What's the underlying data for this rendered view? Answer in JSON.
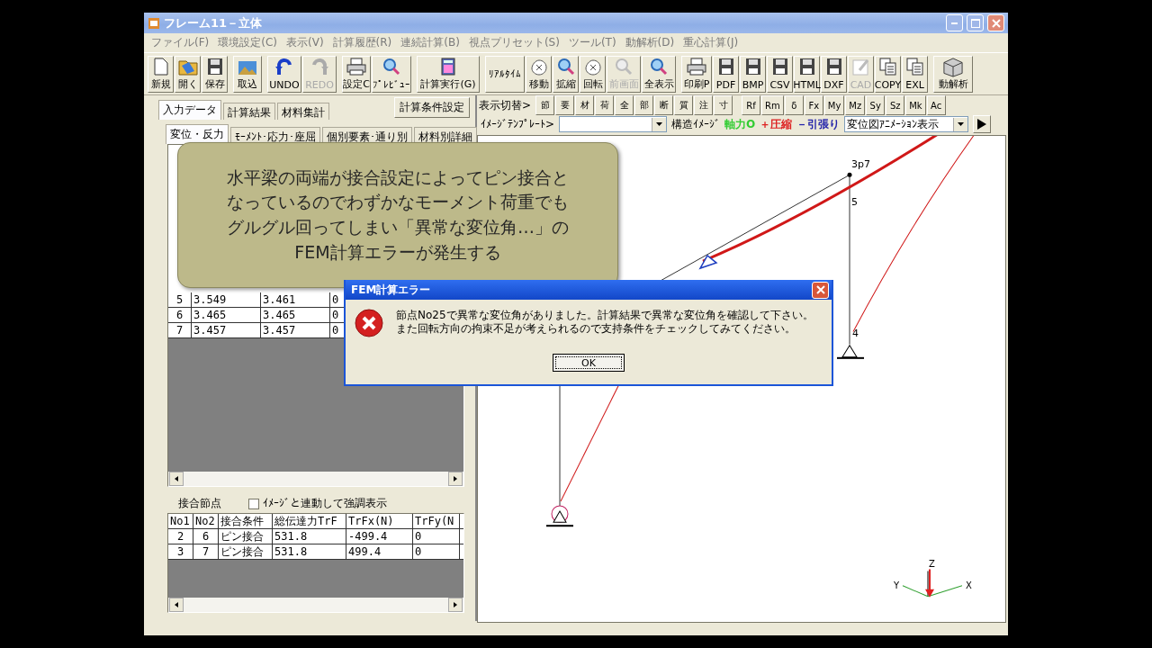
{
  "window": {
    "title": "フレーム11－立体"
  },
  "menu": [
    "ファイル(F)",
    "環境設定(C)",
    "表示(V)",
    "計算履歴(R)",
    "連続計算(B)",
    "視点プリセット(S)",
    "ツール(T)",
    "動解析(D)",
    "重心計算(J)"
  ],
  "toolbar": {
    "groups": [
      [
        {
          "label": "新規",
          "disabled": false
        },
        {
          "label": "開く",
          "disabled": false
        },
        {
          "label": "保存",
          "disabled": false
        }
      ],
      [
        {
          "label": "取込",
          "disabled": false
        }
      ],
      [
        {
          "label": "UNDO",
          "disabled": false
        },
        {
          "label": "REDO",
          "disabled": true
        }
      ],
      [
        {
          "label": "設定C",
          "disabled": false
        },
        {
          "label": "ﾌﾟﾚﾋﾞｭｰ",
          "disabled": false
        }
      ],
      [
        {
          "label": "計算実行(G)",
          "disabled": false
        }
      ],
      [
        {
          "label": "ﾘｱﾙﾀｲﾑ",
          "disabled": false
        },
        {
          "label": "移動",
          "disabled": false
        },
        {
          "label": "拡縮",
          "disabled": false
        },
        {
          "label": "回転",
          "disabled": false
        },
        {
          "label": "前画面",
          "disabled": true
        },
        {
          "label": "全表示",
          "disabled": false
        }
      ],
      [
        {
          "label": "印刷P",
          "disabled": false
        },
        {
          "label": "PDF",
          "disabled": false
        },
        {
          "label": "BMP",
          "disabled": false
        },
        {
          "label": "CSV",
          "disabled": false
        },
        {
          "label": "HTML",
          "disabled": false
        },
        {
          "label": "DXF",
          "disabled": false
        },
        {
          "label": "CAD",
          "disabled": true
        },
        {
          "label": "COPY",
          "disabled": false
        },
        {
          "label": "EXL",
          "disabled": false
        }
      ],
      [
        {
          "label": "動解析",
          "disabled": false
        }
      ]
    ]
  },
  "left_panel": {
    "tabs": [
      {
        "label": "入力データ",
        "selected": true
      },
      {
        "label": "計算結果",
        "selected": false
      },
      {
        "label": "材料集計",
        "selected": false
      }
    ],
    "calc_settings_button": "計算条件設定",
    "subtabs": [
      {
        "label": "変位・反力",
        "selected": true
      },
      {
        "label": "ﾓｰﾒﾝﾄ･応力･座屈",
        "selected": false
      },
      {
        "label": "個別要素･通り別",
        "selected": false
      },
      {
        "label": "材料別詳細",
        "selected": false
      }
    ],
    "results_rows": [
      [
        "5",
        "3.549",
        "3.461",
        "0"
      ],
      [
        "6",
        "3.465",
        "3.465",
        "0"
      ],
      [
        "7",
        "3.457",
        "3.457",
        "0"
      ]
    ],
    "joint_title": "接合節点",
    "highlight_checkbox": {
      "label": "ｲﾒｰｼﾞと連動して強調表示",
      "checked": false
    },
    "joint_table": {
      "columns": [
        "No1",
        "No2",
        "接合条件",
        "総伝達力TrF",
        "TrFx(N)",
        "TrFy(N"
      ],
      "rows": [
        [
          "2",
          "6",
          "ピン接合",
          "531.8",
          "-499.4",
          "0"
        ],
        [
          "3",
          "7",
          "ピン接合",
          "531.8",
          "499.4",
          "0"
        ]
      ]
    }
  },
  "view_toolbar": {
    "label": "表示切替>",
    "group1": [
      "節",
      "要",
      "材",
      "荷",
      "全",
      "部",
      "断",
      "質",
      "注",
      "寸"
    ],
    "group2": [
      "Rf",
      "Rm",
      "δ",
      "Fx",
      "My",
      "Mz",
      "Sy",
      "Sz",
      "Mk",
      "Ac"
    ]
  },
  "image_bar": {
    "template_label": "ｲﾒｰｼﾞﾃﾝﾌﾟﾚｰﾄ>",
    "structure_label": "構造ｲﾒｰｼﾞ",
    "legend": [
      {
        "label": "軸力O",
        "color": "#33cc33"
      },
      {
        "label": "＋圧縮",
        "color": "#dd2222"
      },
      {
        "label": "－引張り",
        "color": "#2222aa"
      }
    ],
    "animation_select": "変位図ｱﾆﾒｰｼｮﾝ表示"
  },
  "canvas": {
    "node_labels": [
      "3p7",
      "5",
      "4"
    ],
    "axis_labels": [
      "Z",
      "Y",
      "X"
    ]
  },
  "annotation": {
    "lines": [
      "水平梁の両端が接合設定によってピン接合と",
      "なっているのでわずかなモーメント荷重でも",
      "グルグル回ってしまい「異常な変位角…」の",
      "FEM計算エラーが発生する"
    ]
  },
  "dialog": {
    "title": "FEM計算エラー",
    "message_lines": [
      "節点No25で異常な変位角がありました。計算結果で異常な変位角を確認して下さい。",
      "また回転方向の拘束不足が考えられるので支持条件をチェックしてみてください。"
    ],
    "ok": "OK"
  }
}
